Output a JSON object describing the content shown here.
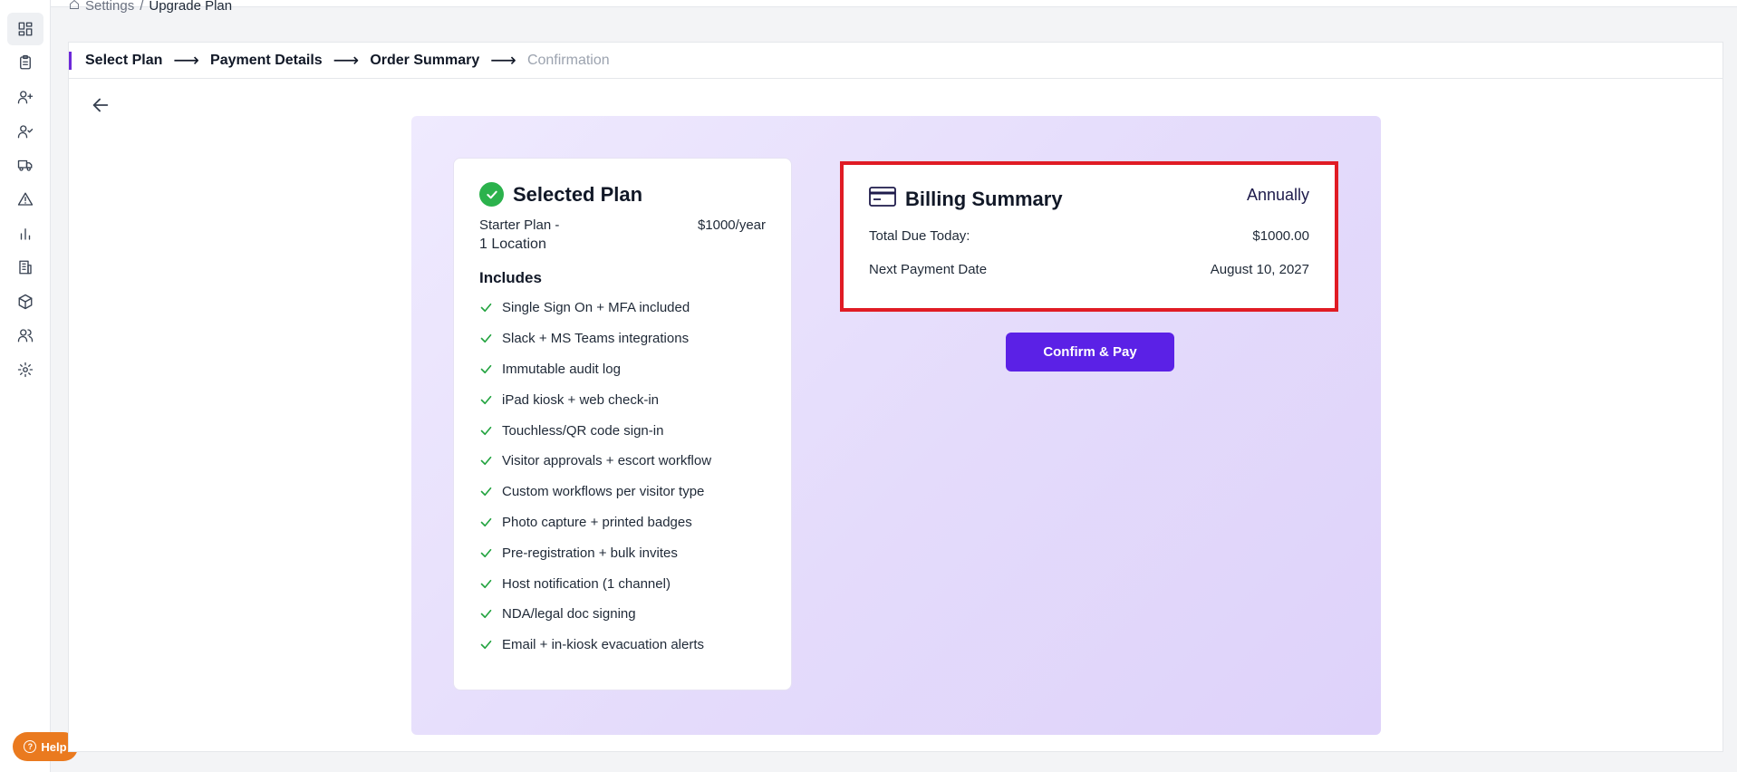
{
  "breadcrumb": {
    "items": [
      "Settings",
      "/",
      "Upgrade Plan"
    ]
  },
  "steps": [
    {
      "label": "Select Plan",
      "state": "done"
    },
    {
      "label": "Payment Details",
      "state": "done"
    },
    {
      "label": "Order Summary",
      "state": "current"
    },
    {
      "label": "Confirmation",
      "state": "pending"
    }
  ],
  "arrow_glyph": "⟶",
  "plan": {
    "title": "Selected Plan",
    "name": "Starter Plan -",
    "price": "$1000/year",
    "locations": "1 Location",
    "includes_label": "Includes",
    "features": [
      "Single Sign On + MFA included",
      "Slack + MS Teams integrations",
      "Immutable audit log",
      "iPad kiosk + web check-in",
      "Touchless/QR code sign-in",
      "Visitor approvals + escort workflow",
      "Custom workflows per visitor type",
      "Photo capture + printed badges",
      "Pre-registration + bulk invites",
      "Host notification (1 channel)",
      "NDA/legal doc signing",
      "Email + in-kiosk evacuation alerts"
    ]
  },
  "billing": {
    "title": "Billing Summary",
    "cycle": "Annually",
    "total_label": "Total Due Today:",
    "total_value": "$1000.00",
    "next_label": "Next Payment Date",
    "next_value": "August 10, 2027"
  },
  "confirm_label": "Confirm & Pay",
  "help_label": "Help",
  "help_glyph": "?",
  "colors": {
    "accent": "#5b21e6",
    "highlight_border": "#e01b24",
    "check_green": "#2bb24c",
    "help_orange": "#ea7a1f"
  },
  "sidebar_icons": [
    "dashboard-icon",
    "clipboard-icon",
    "user-plus-icon",
    "user-check-icon",
    "truck-icon",
    "alert-triangle-icon",
    "bar-chart-icon",
    "building-icon",
    "package-icon",
    "users-icon",
    "gear-icon"
  ]
}
